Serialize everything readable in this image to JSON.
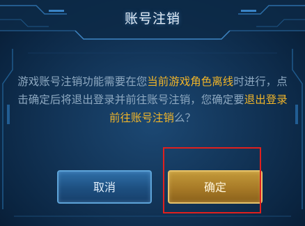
{
  "dialog": {
    "title": "账号注销",
    "message_part1": "游戏账号注销功能需要在您",
    "message_highlight1": "当前游戏角色离线",
    "message_part2": "时进行，点击确定后将退出登录并前往账号注销，您确定要",
    "message_highlight2": "退出登录前往账号注销",
    "message_part3": "么？"
  },
  "buttons": {
    "cancel_label": "取消",
    "confirm_label": "确定"
  },
  "colors": {
    "highlight_text": "#f1b529",
    "annotation_box": "#e0201e"
  }
}
